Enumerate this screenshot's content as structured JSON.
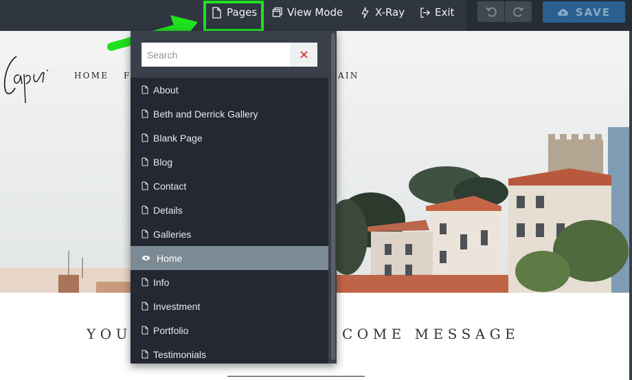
{
  "toolbar": {
    "pages_label": "Pages",
    "pages_icon": "page-icon",
    "view_mode_label": "View Mode",
    "view_mode_icon": "window-icon",
    "xray_label": "X-Ray",
    "xray_icon": "bolt-icon",
    "exit_label": "Exit",
    "exit_icon": "exit-icon",
    "undo_icon": "undo-icon",
    "redo_icon": "redo-icon",
    "save_label": "SAVE",
    "save_icon": "cloud-upload-icon"
  },
  "pages_dropdown": {
    "search_placeholder": "Search",
    "search_value": "",
    "clear_icon": "close-icon",
    "items": [
      {
        "label": "About",
        "icon": "page-icon",
        "active": false
      },
      {
        "label": "Beth and Derrick Gallery",
        "icon": "page-icon",
        "active": false
      },
      {
        "label": "Blank Page",
        "icon": "page-icon",
        "active": false
      },
      {
        "label": "Blog",
        "icon": "page-icon",
        "active": false
      },
      {
        "label": "Contact",
        "icon": "page-icon",
        "active": false
      },
      {
        "label": "Details",
        "icon": "page-icon",
        "active": false
      },
      {
        "label": "Galleries",
        "icon": "page-icon",
        "active": false
      },
      {
        "label": "Home",
        "icon": "eye-icon",
        "active": true
      },
      {
        "label": "Info",
        "icon": "page-icon",
        "active": false
      },
      {
        "label": "Investment",
        "icon": "page-icon",
        "active": false
      },
      {
        "label": "Portfolio",
        "icon": "page-icon",
        "active": false
      },
      {
        "label": "Testimonials",
        "icon": "page-icon",
        "active": false
      }
    ]
  },
  "site": {
    "nav_home": "HOME",
    "nav_partial_left": "F",
    "nav_partial_right": "AIN",
    "welcome_left": "YOU",
    "welcome_right": "COME MESSAGE"
  },
  "colors": {
    "toolbar_bg": "#2f3640",
    "dropdown_bg": "#232832",
    "active_item_bg": "#7c8a95",
    "highlight_green": "#1fe21f",
    "save_blue": "#2a5f8f",
    "clear_red": "#d9342b"
  }
}
